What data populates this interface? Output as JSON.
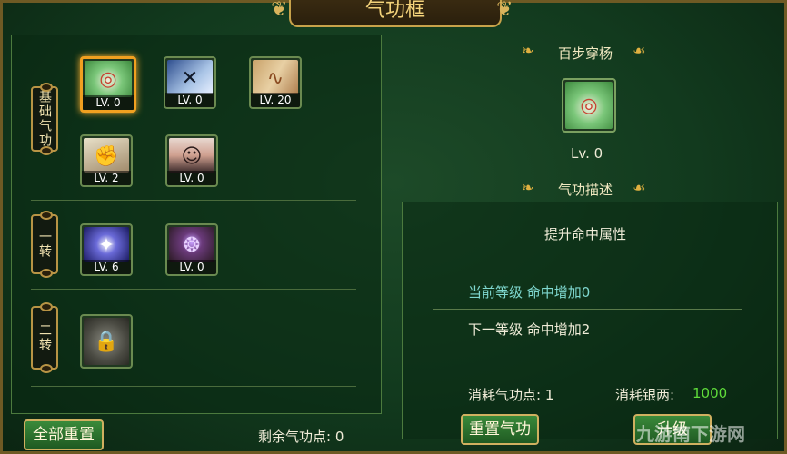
{
  "title": "气功框",
  "left": {
    "rows": [
      {
        "label": "基础气功"
      },
      {
        "label": "一转"
      },
      {
        "label": "二转"
      }
    ],
    "skills": [
      {
        "level": "LV. 0"
      },
      {
        "level": "LV. 0"
      },
      {
        "level": "LV. 20"
      },
      {
        "level": "LV. 2"
      },
      {
        "level": "LV. 0"
      },
      {
        "level": "LV. 6"
      },
      {
        "level": "LV. 0"
      }
    ],
    "reset_all": "全部重置",
    "remaining_label": "剩余气功点: 0"
  },
  "right": {
    "skill_name": "百步穿杨",
    "skill_level": "Lv. 0",
    "desc_title": "气功描述",
    "desc_main": "提升命中属性",
    "current_level": "当前等级  命中增加0",
    "next_level": "下一等级  命中增加2",
    "cost_points": "消耗气功点: 1",
    "cost_silver_label": "消耗银两:",
    "cost_silver_value": "1000",
    "reset_button": "重置气功",
    "upgrade_button": "升级"
  },
  "watermark": "九游南下游网",
  "colors": {
    "accent": "#c8a24a",
    "current_level": "#7fd8d0",
    "silver": "#5fdc3a"
  }
}
